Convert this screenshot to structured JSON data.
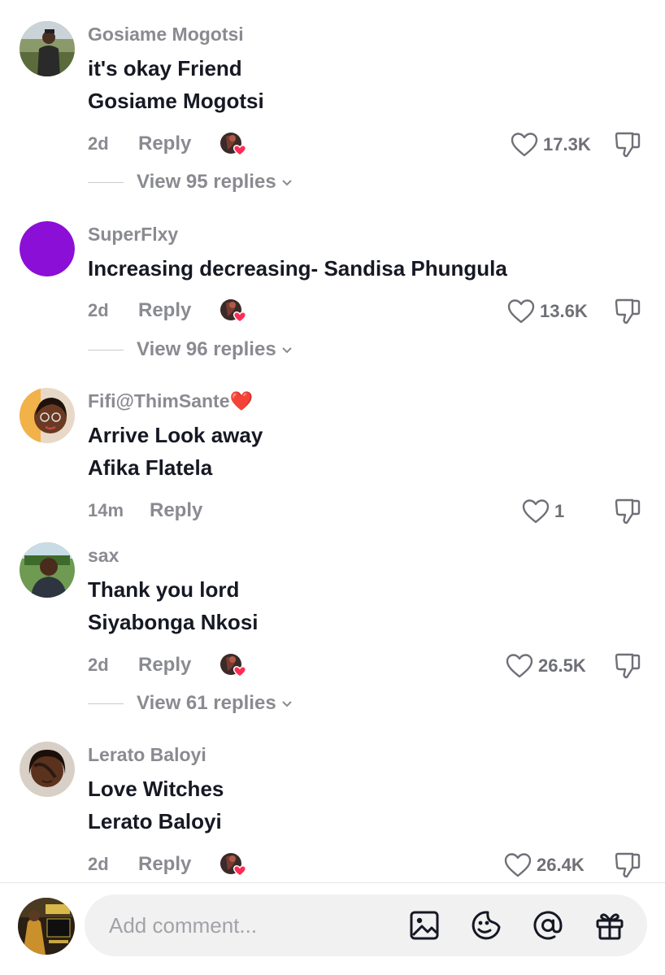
{
  "comments": [
    {
      "username": "Gosiame Mogotsi",
      "lines": [
        "it's okay Friend",
        "Gosiame Mogotsi"
      ],
      "time": "2d",
      "reply_label": "Reply",
      "creator_liked": true,
      "likes": "17.3K",
      "view_replies": "View 95 replies"
    },
    {
      "username": "SuperFlxy",
      "lines": [
        "Increasing decreasing- Sandisa Phungula"
      ],
      "time": "2d",
      "reply_label": "Reply",
      "creator_liked": true,
      "likes": "13.6K",
      "view_replies": "View 96 replies"
    },
    {
      "username": "Fifi@ThimSante❤️",
      "lines": [
        "Arrive Look away",
        "Afika Flatela"
      ],
      "time": "14m",
      "reply_label": "Reply",
      "creator_liked": false,
      "likes": "1",
      "view_replies": ""
    },
    {
      "username": "sax",
      "lines": [
        "Thank you lord",
        "Siyabonga Nkosi"
      ],
      "time": "2d",
      "reply_label": "Reply",
      "creator_liked": true,
      "likes": "26.5K",
      "view_replies": "View 61 replies"
    },
    {
      "username": "Lerato Baloyi",
      "lines": [
        "Love Witches",
        "Lerato Baloyi"
      ],
      "time": "2d",
      "reply_label": "Reply",
      "creator_liked": true,
      "likes": "26.4K",
      "view_replies": ""
    }
  ],
  "input": {
    "placeholder": "Add comment...",
    "value": ""
  },
  "icons": {
    "image": "image-icon",
    "sticker": "sticker-icon",
    "mention": "mention-icon",
    "gift": "gift-icon",
    "like": "heart-outline-icon",
    "dislike": "thumbs-down-icon",
    "chevron": "chevron-down-icon"
  },
  "colors": {
    "primary_text": "#161823",
    "secondary_text": "#8a8b91",
    "heart_red": "#fe2c55",
    "input_bg": "#f1f1f2"
  }
}
